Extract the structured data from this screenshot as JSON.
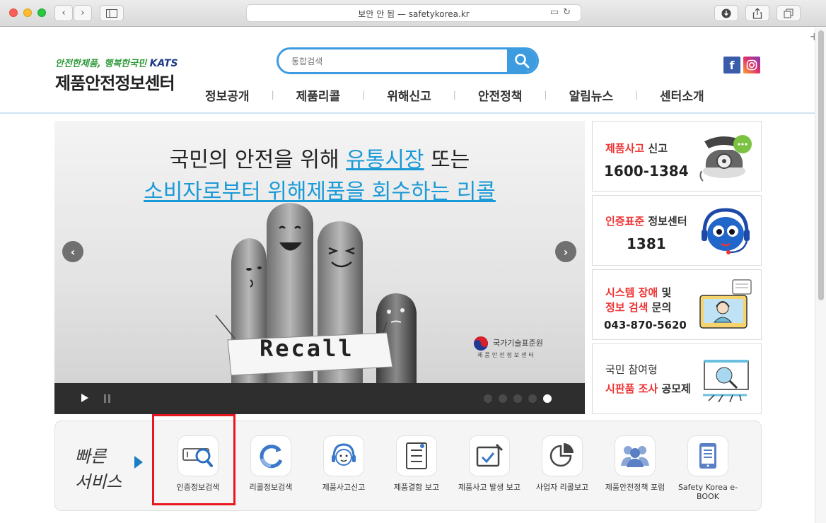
{
  "browser": {
    "url": "보안 안 됨 — safetykorea.kr"
  },
  "header": {
    "slogan": "안전한제품, 행복한국민",
    "brand": "KATS",
    "site_title": "제품안전정보센터",
    "search_placeholder": "통합검색",
    "social": [
      "f"
    ]
  },
  "gnb": {
    "items": [
      "정보공개",
      "제품리콜",
      "위해신고",
      "안전정책",
      "알림뉴스",
      "센터소개"
    ]
  },
  "banner": {
    "line1_pre": "국민의 안전을 위해 ",
    "line1_highlight": "유통시장",
    "line1_post": " 또는",
    "line2": "소비자로부터 위해제품을 회수하는 리콜",
    "sign_text": "Recall",
    "org_name": "국가기술표준원",
    "org_sub": "제품안전정보센터",
    "slide_count": 5,
    "active_slide": 5
  },
  "cards": [
    {
      "title_red": "제품사고",
      "title_rest": " 신고",
      "number": "1600-1384"
    },
    {
      "title_red": "인증표준",
      "title_rest": " 정보센터",
      "number": "1381"
    },
    {
      "line1_red": "시스템 장애",
      "line1_rest": " 및",
      "line2_red": "정보 검색",
      "line2_rest": " 문의",
      "number": "043-870-5620"
    },
    {
      "line1": "국민 참여형",
      "line2_red": "시판품 조사",
      "line2_rest": " 공모제"
    }
  ],
  "quick": {
    "title_line1": "빠른",
    "title_line2": "서비스",
    "services": [
      {
        "label": "인증정보검색"
      },
      {
        "label": "리콜정보검색"
      },
      {
        "label": "제품사고신고"
      },
      {
        "label": "제품결함 보고"
      },
      {
        "label": "제품사고 발생 보고"
      },
      {
        "label": "사업자 리콜보고"
      },
      {
        "label": "제품안전정책 포럼"
      },
      {
        "label": "Safety Korea e-BOOK"
      }
    ],
    "highlighted_index": 0
  },
  "colors": {
    "accent": "#3d9be0",
    "banner_highlight": "#1a9ad6",
    "card_red": "#e33333",
    "highlight_box": "#e8161d"
  }
}
